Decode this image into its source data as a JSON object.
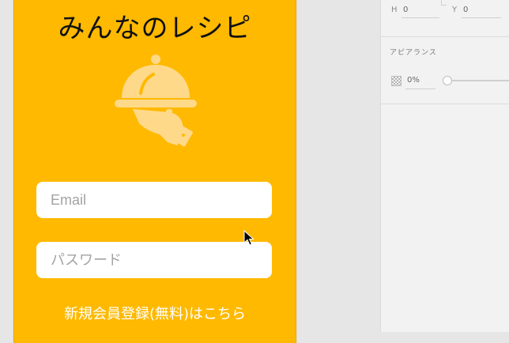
{
  "app": {
    "title": "みんなのレシピ",
    "email_placeholder": "Email",
    "password_placeholder": "パスワード",
    "signup_link": "新規会員登録(無料)はこちら"
  },
  "inspector": {
    "h_label": "H",
    "h_value": "0",
    "y_label": "Y",
    "y_value": "0",
    "appearance_title": "アピアランス",
    "opacity_value": "0%"
  },
  "colors": {
    "artboard": "#ffb900",
    "panel": "#f2f2f2",
    "canvas": "#e6e6e6"
  },
  "icons": {
    "logo": "serving-cloche-hand-icon",
    "opacity": "checkerboard-icon",
    "cursor": "arrow-cursor-icon"
  }
}
